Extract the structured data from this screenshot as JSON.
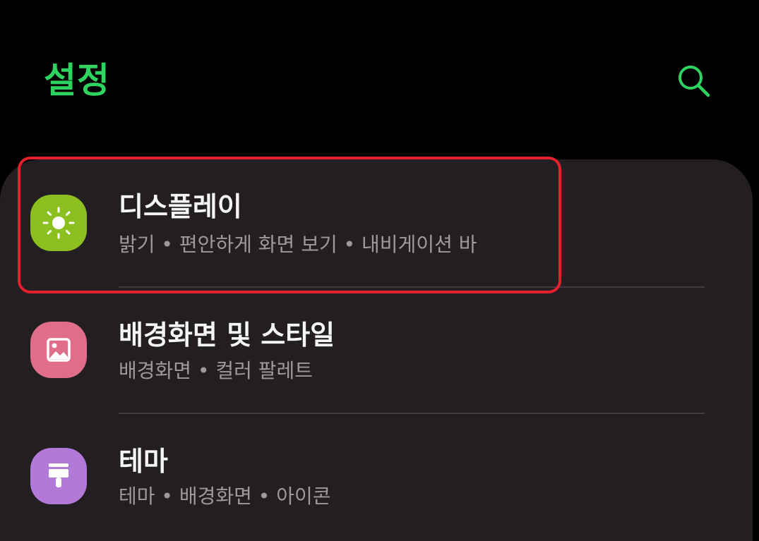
{
  "header": {
    "title": "설정",
    "search_icon": "search-icon"
  },
  "highlight_color": "#e3202b",
  "accent_color": "#2fd35f",
  "settings": {
    "items": [
      {
        "title": "디스플레이",
        "subtitle": "밝기 • 편안하게 화면 보기 • 내비게이션 바",
        "icon": "brightness-icon",
        "icon_color": "#8cc021",
        "highlighted": true
      },
      {
        "title": "배경화면 및 스타일",
        "subtitle": "배경화면 • 컬러 팔레트",
        "icon": "wallpaper-icon",
        "icon_color": "#e06d8a"
      },
      {
        "title": "테마",
        "subtitle": "테마 • 배경화면 • 아이콘",
        "icon": "paintbrush-icon",
        "icon_color": "#b279d8"
      }
    ]
  }
}
